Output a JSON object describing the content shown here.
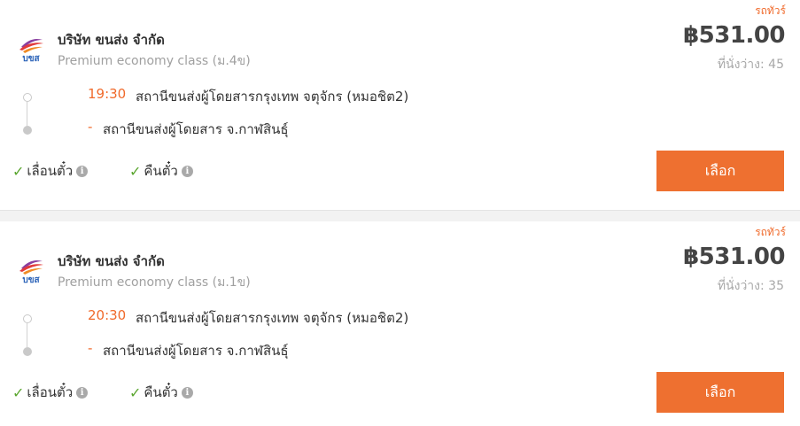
{
  "trips": [
    {
      "tag": "รถทัวร์",
      "company": "บริษัท ขนส่ง จำกัด",
      "vehicle_class": "Premium economy class (ม.4ข)",
      "price": "฿531.00",
      "seats": "ที่นั่งว่าง: 45",
      "departure_time": "19:30",
      "departure_station": "สถานีขนส่งผู้โดยสารกรุงเทพ จตุจักร (หมอชิต2)",
      "arrival_dash": "-",
      "arrival_station": "สถานีขนส่งผู้โดยสาร จ.กาฬสินธุ์",
      "features": [
        "เลื่อนตั๋ว",
        "คืนตั๋ว"
      ],
      "select_label": "เลือก"
    },
    {
      "tag": "รถทัวร์",
      "company": "บริษัท ขนส่ง จำกัด",
      "vehicle_class": "Premium economy class (ม.1ข)",
      "price": "฿531.00",
      "seats": "ที่นั่งว่าง: 35",
      "departure_time": "20:30",
      "departure_station": "สถานีขนส่งผู้โดยสารกรุงเทพ จตุจักร (หมอชิต2)",
      "arrival_dash": "-",
      "arrival_station": "สถานีขนส่งผู้โดยสาร จ.กาฬสินธุ์",
      "features": [
        "เลื่อนตั๋ว",
        "คืนตั๋ว"
      ],
      "select_label": "เลือก"
    }
  ],
  "logo_text": "บขส",
  "icons": {
    "check": "check-icon",
    "info": "info-icon",
    "logo": "bks-logo-icon"
  },
  "colors": {
    "accent": "#ee7030",
    "check": "#5aa62f",
    "muted": "#a8a8a8"
  }
}
